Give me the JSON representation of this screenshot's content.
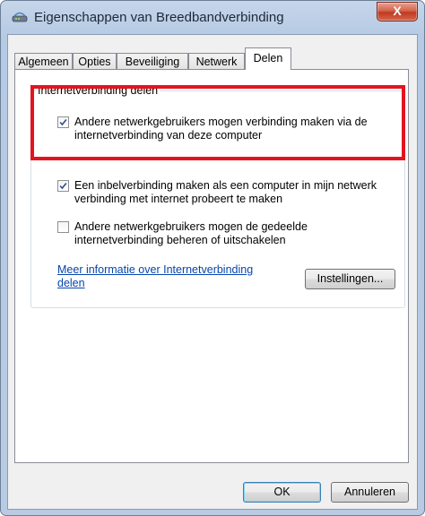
{
  "window": {
    "title": "Eigenschappen van Breedbandverbinding",
    "close_label": "X"
  },
  "tabs": [
    {
      "label": "Algemeen",
      "active": false
    },
    {
      "label": "Opties",
      "active": false
    },
    {
      "label": "Beveiliging",
      "active": false
    },
    {
      "label": "Netwerk",
      "active": false
    },
    {
      "label": "Delen",
      "active": true
    }
  ],
  "group": {
    "label": "Internetverbinding delen",
    "options": [
      {
        "line1": "Andere netwerkgebruikers mogen verbinding maken via de",
        "line2": "internetverbinding van deze computer",
        "checked": true
      },
      {
        "line1": "Een inbelverbinding maken als een computer in mijn netwerk",
        "line2": "verbinding met internet probeert te maken",
        "checked": true
      },
      {
        "line1": "Andere netwerkgebruikers mogen de gedeelde",
        "line2": "internetverbinding beheren of uitschakelen",
        "checked": false
      }
    ],
    "link_line1": "Meer informatie over Internetverbinding",
    "link_line2": "delen",
    "settings_button": "Instellingen..."
  },
  "footer": {
    "ok_button": "OK",
    "cancel_button": "Annuleren"
  },
  "colors": {
    "highlight": "#e3141f",
    "link": "#0645ad",
    "checkmark": "#2a4a8f"
  }
}
